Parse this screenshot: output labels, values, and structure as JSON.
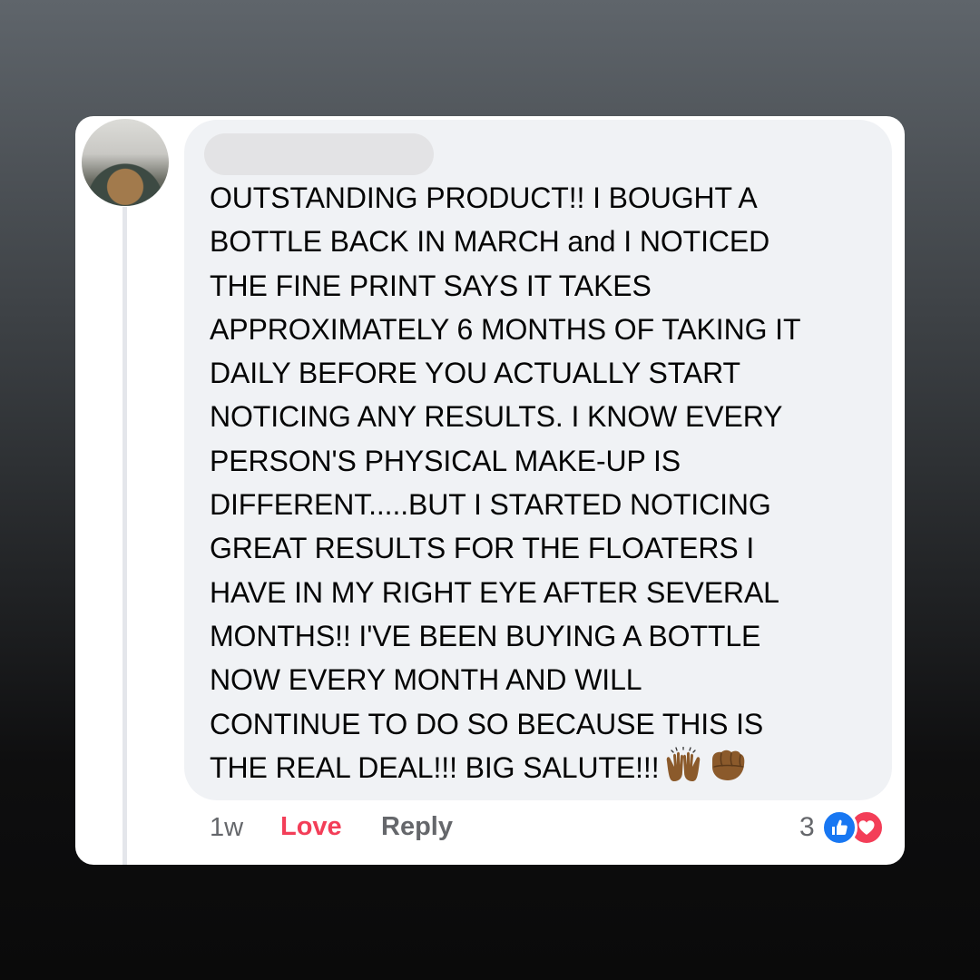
{
  "comment": {
    "author_name": "",
    "lines": [
      "OUTSTANDING PRODUCT!!  I BOUGHT A",
      "BOTTLE BACK IN MARCH and I NOTICED",
      "THE FINE PRINT SAYS IT TAKES",
      "APPROXIMATELY 6 MONTHS OF TAKING IT",
      "DAILY BEFORE YOU ACTUALLY START",
      "NOTICING ANY RESULTS. I KNOW EVERY",
      "PERSON'S PHYSICAL MAKE-UP IS",
      "DIFFERENT.....BUT I STARTED NOTICING",
      "GREAT RESULTS FOR THE FLOATERS I",
      "HAVE IN MY RIGHT EYE AFTER SEVERAL",
      "MONTHS!! I'VE BEEN BUYING A BOTTLE",
      "NOW EVERY MONTH AND WILL",
      "CONTINUE TO DO SO BECAUSE THIS IS",
      "THE REAL DEAL!!!  BIG SALUTE!!!"
    ],
    "emojis": [
      "raising-hands-emoji",
      "oncoming-fist-emoji"
    ]
  },
  "actions": {
    "timestamp": "1w",
    "love_label": "Love",
    "reply_label": "Reply"
  },
  "reactions": {
    "count": "3",
    "types": [
      "like-icon",
      "heart-icon"
    ]
  },
  "colors": {
    "love_red": "#f33e58",
    "like_blue": "#1877f2",
    "bubble_bg": "#f0f2f5",
    "meta_gray": "#65676b"
  }
}
